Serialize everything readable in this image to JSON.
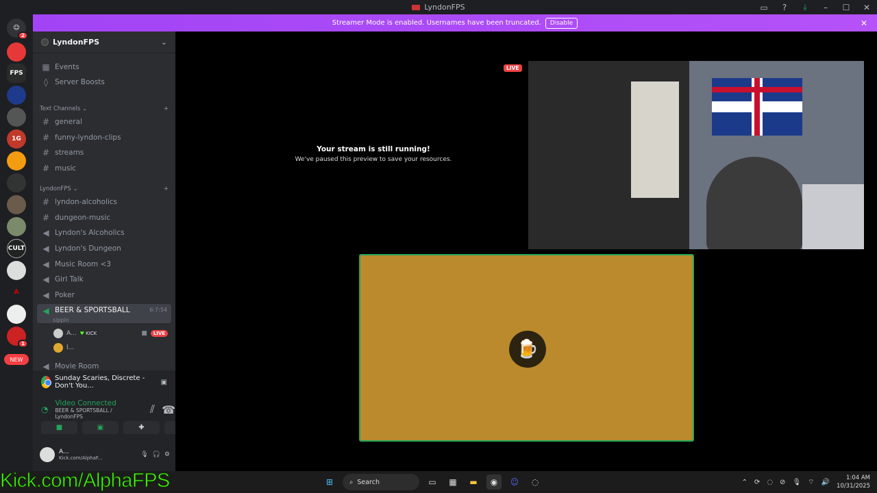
{
  "window": {
    "title": "LyndonFPS"
  },
  "banner": {
    "text": "Streamer Mode is enabled. Usernames have been truncated.",
    "disable_label": "Disable"
  },
  "servers": {
    "badge_home": "2",
    "badge_other": "1",
    "new_label": "NEW",
    "colors": [
      "#e63838",
      "#2b2b2b",
      "#1e3a8a",
      "#555",
      "#c0392b",
      "#f39c12",
      "#333",
      "#6b5b4b",
      "#7a8a6a",
      "#222",
      "#ddd",
      "#d00",
      "#eee",
      "#c22"
    ]
  },
  "sidebar": {
    "server_name": "LyndonFPS",
    "top_items": [
      {
        "label": "Events",
        "icon": "calendar-icon"
      },
      {
        "label": "Server Boosts",
        "icon": "boost-icon"
      }
    ],
    "categories": [
      {
        "label": "Text Channels"
      },
      {
        "label": "LyndonFPS"
      }
    ],
    "text_channels": [
      "general",
      "funny-lyndon-clips",
      "streams",
      "music"
    ],
    "lyndon_channels": [
      {
        "label": "lyndon-alcoholics",
        "type": "text"
      },
      {
        "label": "dungeon-music",
        "type": "text"
      },
      {
        "label": "Lyndon's Alcoholics",
        "type": "voice"
      },
      {
        "label": "Lyndon's Dungeon",
        "type": "voice"
      },
      {
        "label": "Music Room <3",
        "type": "voice"
      },
      {
        "label": "Girl Talk",
        "type": "voice"
      },
      {
        "label": "Poker",
        "type": "voice"
      }
    ],
    "active_channel": {
      "label": "BEER & SPORTSBALL",
      "status": "sippin",
      "timer": "6:7:54"
    },
    "members": [
      {
        "name": "A...",
        "tag": "KICK",
        "live": "LIVE"
      },
      {
        "name": "l..."
      }
    ],
    "next_channel": "Movie Room"
  },
  "activity": {
    "text": "Sunday Scaries, Discrete - Don't You..."
  },
  "voice": {
    "title": "Video Connected",
    "subtitle": "BEER & SPORTSBALL / LyndonFPS",
    "user_name": "A...",
    "user_status": "Kick.com/AlphaF..."
  },
  "stream": {
    "paused_title": "Your stream is still running!",
    "paused_sub": "We've paused this preview to save your resources.",
    "live_label": "LIVE"
  },
  "overlay": {
    "kick_text": "Kick.com/AlphaFPS"
  },
  "taskbar": {
    "search": "Search",
    "time": "1:04 AM",
    "date": "10/31/2025"
  }
}
